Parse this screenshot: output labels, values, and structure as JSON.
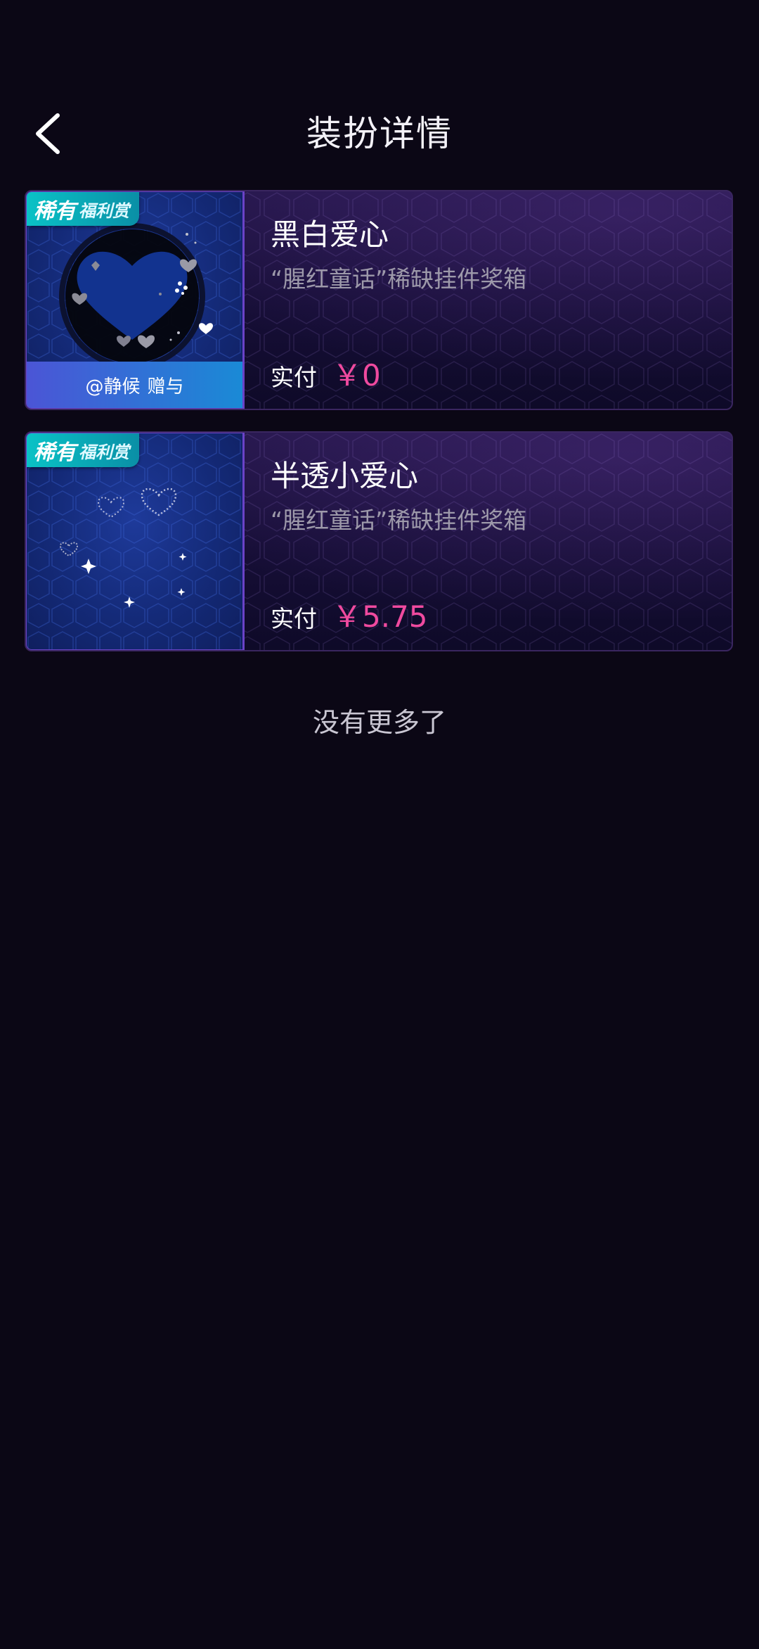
{
  "header": {
    "title": "装扮详情"
  },
  "items": [
    {
      "name": "黑白爱心",
      "source": "“腥红童话”稀缺挂件奖箱",
      "badge_main": "稀有",
      "badge_sub": "福利赏",
      "gift_user": "@静候",
      "gift_action": "赠与",
      "pay_label": "实付",
      "pay_amount": "￥0"
    },
    {
      "name": "半透小爱心",
      "source": "“腥红童话”稀缺挂件奖箱",
      "badge_main": "稀有",
      "badge_sub": "福利赏",
      "pay_label": "实付",
      "pay_amount": "￥5.75"
    }
  ],
  "footer": {
    "no_more": "没有更多了"
  },
  "colors": {
    "background": "#0b0715",
    "price": "#f04a9f",
    "badge": "#0ac2c6",
    "gift_bar_start": "#4b55d6",
    "gift_bar_end": "#1a8ad6"
  }
}
